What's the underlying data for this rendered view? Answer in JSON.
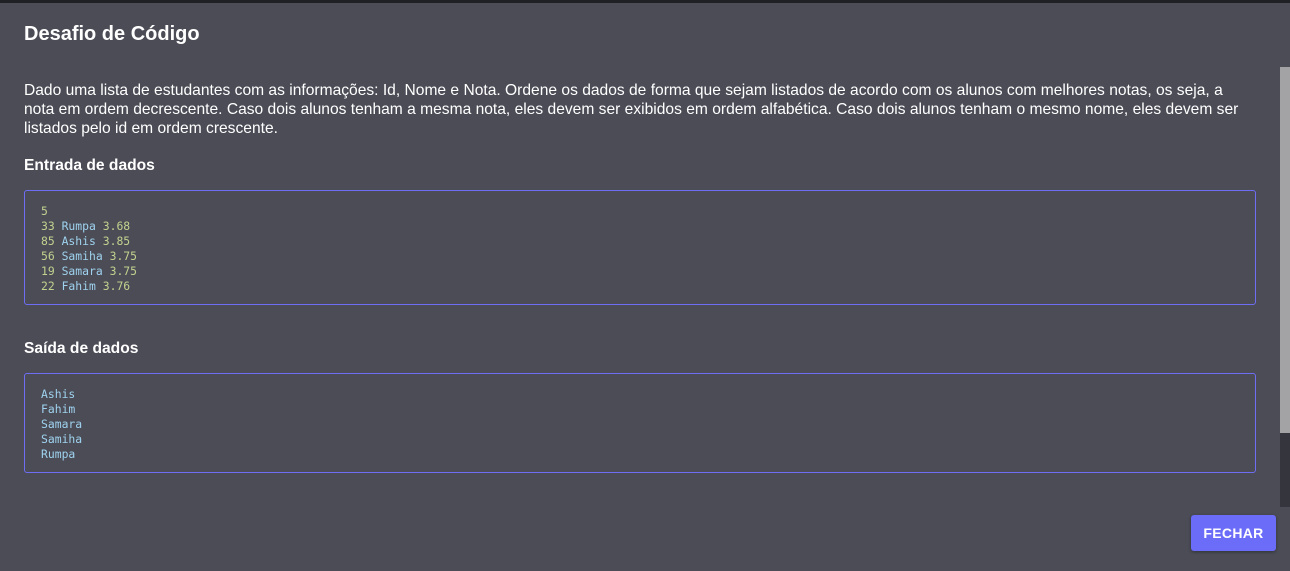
{
  "dialog": {
    "title": "Desafio de Código",
    "description": "Dado uma lista de estudantes com as informações: Id, Nome e Nota. Ordene os dados de forma que sejam listados de acordo com os alunos com melhores notas, os seja, a nota em ordem decrescente. Caso dois alunos tenham a mesma nota, eles devem ser exibidos em ordem alfabética. Caso dois alunos tenham o mesmo nome, eles devem ser listados pelo id em ordem crescente.",
    "input_title": "Entrada de dados",
    "input": {
      "count": "5",
      "rows": [
        {
          "id": "33",
          "name": "Rumpa",
          "grade": "3.68"
        },
        {
          "id": "85",
          "name": "Ashis",
          "grade": "3.85"
        },
        {
          "id": "56",
          "name": "Samiha",
          "grade": "3.75"
        },
        {
          "id": "19",
          "name": "Samara",
          "grade": "3.75"
        },
        {
          "id": "22",
          "name": "Fahim",
          "grade": "3.76"
        }
      ]
    },
    "output_title": "Saída de dados",
    "output": [
      "Ashis",
      "Fahim",
      "Samara",
      "Samiha",
      "Rumpa"
    ],
    "close_label": "FECHAR"
  },
  "colors": {
    "dialog_bg": "#4b4c56",
    "accent": "#6b6cf8",
    "code_border": "#6e6ef5",
    "code_number": "#c2d18e",
    "code_name": "#9fd2ee"
  }
}
